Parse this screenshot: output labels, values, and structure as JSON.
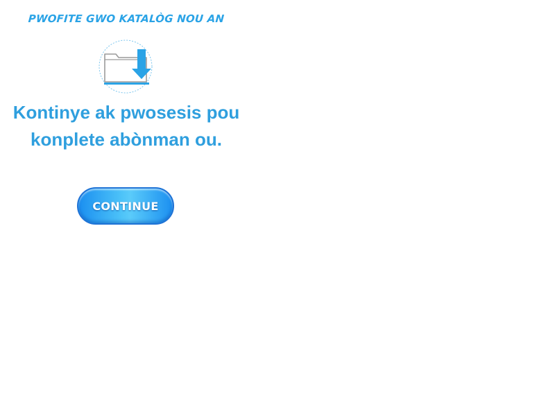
{
  "promo": {
    "headline": "PWOFITE GWO KATALÒG NOU AN"
  },
  "icon": {
    "name": "folder-download-icon"
  },
  "message": {
    "line1": "Kontinye ak pwosesis pou",
    "line2": "konplete abònman ou."
  },
  "continue_button": {
    "label": "CONTINUE"
  },
  "colors": {
    "accent": "#2f9fde",
    "button_dark": "#1b8ff0",
    "button_light": "#5acbfa"
  }
}
